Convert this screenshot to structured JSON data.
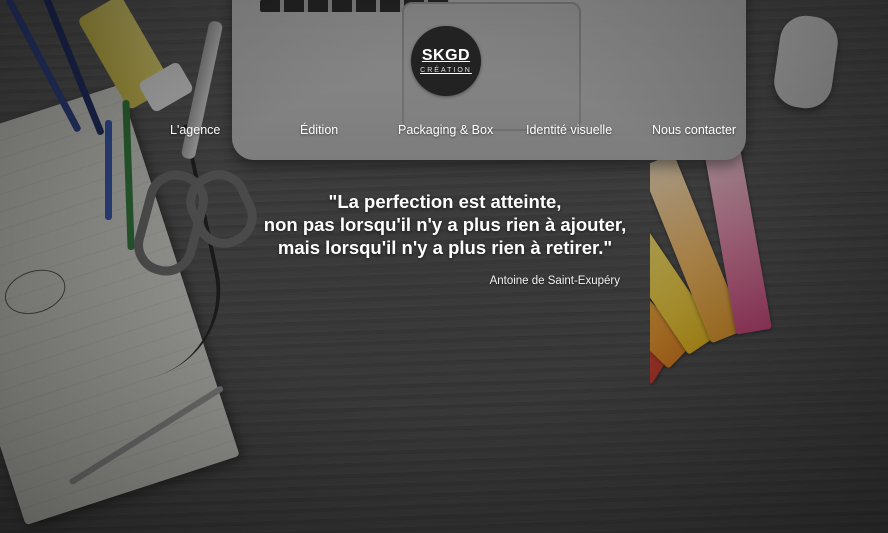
{
  "logo": {
    "main": "SKGD",
    "sub": "CRÉATION"
  },
  "nav": {
    "items": [
      {
        "label": "L'agence"
      },
      {
        "label": "Édition"
      },
      {
        "label": "Packaging & Box"
      },
      {
        "label": "Identité visuelle"
      },
      {
        "label": "Nous contacter"
      }
    ]
  },
  "quote": {
    "lines": [
      "\"La perfection est atteinte,",
      "non pas lorsqu'il n'y a plus rien à ajouter,",
      "mais lorsqu'il n'y a plus rien à retirer.\""
    ],
    "author": "Antoine de Saint-Exupéry"
  },
  "colors": {
    "text": "#ffffff",
    "logo_bg": "#222222",
    "desk": "#505050"
  },
  "icons": {
    "logo": "circle-logo-badge"
  }
}
